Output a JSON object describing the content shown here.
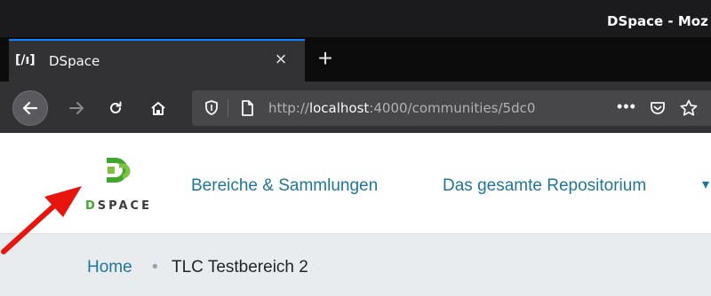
{
  "window": {
    "title": "DSpace - Moz"
  },
  "tabs": [
    {
      "title": "DSpace",
      "favicon": "dspace-favicon",
      "active": true
    }
  ],
  "toolbar": {
    "url_scheme": "http://",
    "url_host": "localhost",
    "url_rest": ":4000/communities/5dc0",
    "more_label": "•••"
  },
  "site": {
    "logo_text_first": "D",
    "logo_text_rest": "SPACE",
    "brand_color": "#43a72f",
    "link_color": "#207698",
    "nav": [
      {
        "label": "Bereiche & Sammlungen"
      },
      {
        "label": "Das gesamte Repositorium"
      }
    ]
  },
  "breadcrumb": {
    "home": "Home",
    "separator": "•",
    "current": "TLC Testbereich 2"
  },
  "annotation": {
    "arrow_color": "#e8150f"
  }
}
